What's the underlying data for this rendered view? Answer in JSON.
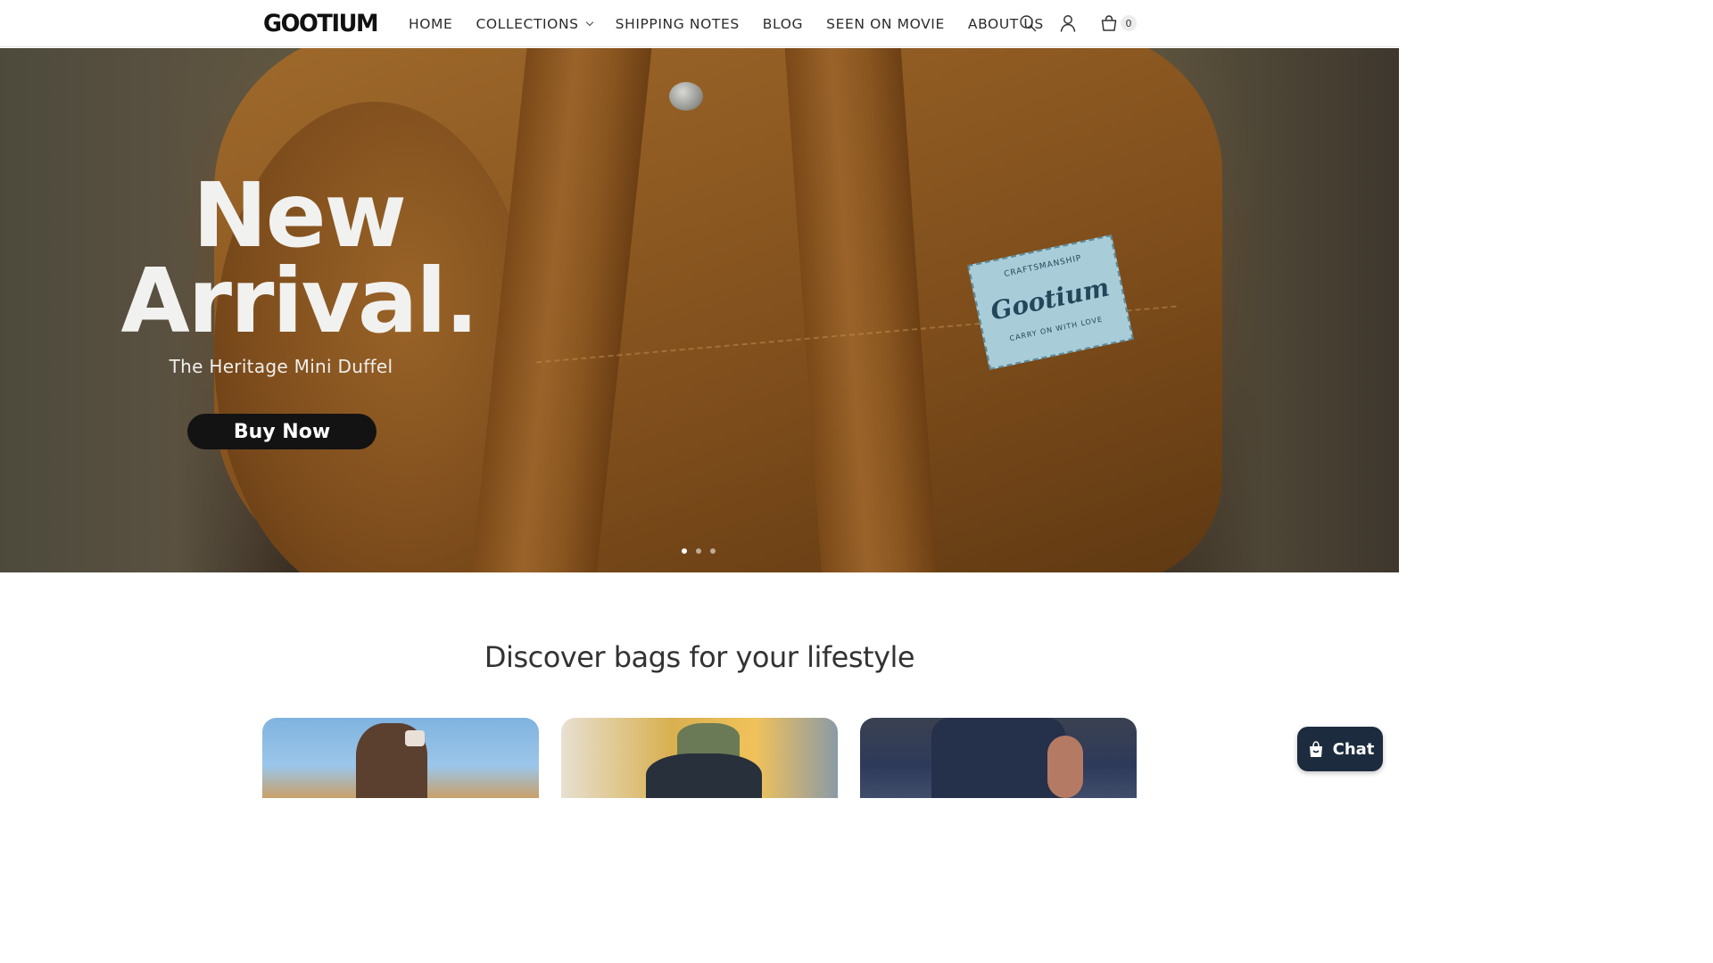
{
  "header": {
    "logo": "GOOTIUM",
    "nav": [
      {
        "label": "HOME"
      },
      {
        "label": "COLLECTIONS",
        "dropdown": true
      },
      {
        "label": "SHIPPING NOTES"
      },
      {
        "label": "BLOG"
      },
      {
        "label": "SEEN ON MOVIE"
      },
      {
        "label": "ABOUT US"
      }
    ],
    "icons": [
      "search-icon",
      "account-icon",
      "cart-icon"
    ],
    "cart_count": "0"
  },
  "hero": {
    "title_line1": "New",
    "title_line2": "Arrival.",
    "subtitle": "The Heritage Mini Duffel",
    "button_label": "Buy Now",
    "patch_text": "Gootium",
    "patch_top": "CRAFTSMANSHIP",
    "patch_bottom": "CARRY ON WITH LOVE",
    "slides": 3,
    "active_slide": 1
  },
  "section": {
    "title": "Discover bags for your lifestyle"
  },
  "chat": {
    "label": "Chat"
  }
}
